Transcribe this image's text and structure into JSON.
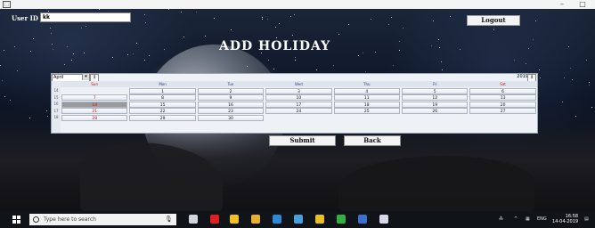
{
  "window": {
    "app_icon": "app-window-icon",
    "minimize_label": "–",
    "maximize_label": "□"
  },
  "header": {
    "user_id_label": "User ID",
    "user_id_value": "kk",
    "logout_label": "Logout",
    "title": "ADD HOLIDAY"
  },
  "calendar": {
    "month": "April",
    "month_dropdown_icon": "chevron-down-icon",
    "year": "2019",
    "days_of_week": [
      "Sun",
      "Mon",
      "Tue",
      "Wed",
      "Thu",
      "Fri",
      "Sat"
    ],
    "week_numbers": [
      "14",
      "15",
      "16",
      "17",
      "18"
    ],
    "weeks": [
      [
        "",
        "1",
        "2",
        "3",
        "4",
        "5",
        "6"
      ],
      [
        "7",
        "8",
        "9",
        "10",
        "11",
        "12",
        "13"
      ],
      [
        "14",
        "15",
        "16",
        "17",
        "18",
        "19",
        "20"
      ],
      [
        "21",
        "22",
        "23",
        "24",
        "25",
        "26",
        "27"
      ],
      [
        "28",
        "29",
        "30",
        "",
        "",
        "",
        ""
      ]
    ],
    "selected_day": "14",
    "weekend_color": "#c01010",
    "selected_color": "#9a9a9a"
  },
  "actions": {
    "submit_label": "Submit",
    "back_label": "Back"
  },
  "taskbar": {
    "start_icon": "windows-logo-icon",
    "search_placeholder": "Type here to search",
    "mic_icon": "microphone-icon",
    "apps": [
      {
        "name": "task-view-icon",
        "color": "#cfd6de"
      },
      {
        "name": "opera-icon",
        "color": "#e02020"
      },
      {
        "name": "notes-icon",
        "color": "#f0c020"
      },
      {
        "name": "file-explorer-icon",
        "color": "#e8b030"
      },
      {
        "name": "edge-icon",
        "color": "#2a8ad8"
      },
      {
        "name": "tool-icon",
        "color": "#46a0e0"
      },
      {
        "name": "chrome-icon",
        "color": "#e8c020"
      },
      {
        "name": "app-green-icon",
        "color": "#30b040"
      },
      {
        "name": "app-blue-icon",
        "color": "#3a70d0"
      },
      {
        "name": "app-window-icon",
        "color": "#d8d8e8"
      }
    ],
    "tray_language": "ENG",
    "clock_time": "16:58",
    "clock_date": "14-04-2019"
  }
}
